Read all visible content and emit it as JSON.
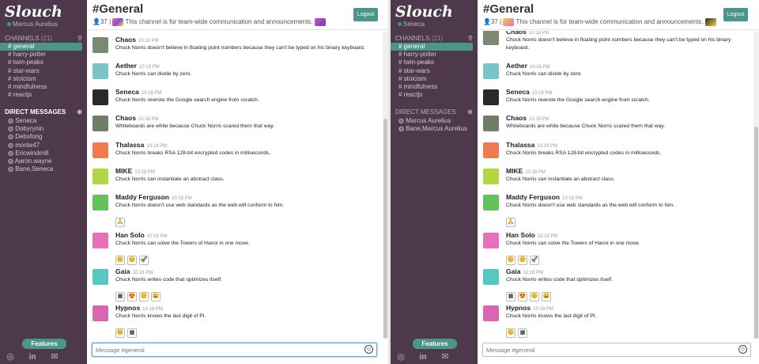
{
  "app": {
    "name": "Slouch"
  },
  "colors": {
    "sidebar": "#4d394b",
    "accent": "#4c9689",
    "presence": "#38978d"
  },
  "left": {
    "user": "Marcus Aurelius",
    "channels_label": "CHANNELS",
    "channels_count": "(21)",
    "channels": [
      "# general",
      "# harry-potter",
      "# twin-peaks",
      "# star-wars",
      "# stoicism",
      "# mindfulness",
      "# reactjs"
    ],
    "dm_label": "DIRECT MESSAGES",
    "dms": [
      "Seneca",
      "Dobyrynin",
      "Debsfong",
      "monte47",
      "Ericwindmill",
      "Aaron.wayne",
      "Bane,Seneca"
    ]
  },
  "right": {
    "user": "Seneca",
    "channels_label": "CHANNELS",
    "channels_count": "(21)",
    "channels": [
      "# general",
      "# harry-potter",
      "# twin-peaks",
      "# star-wars",
      "# stoicism",
      "# mindfulness",
      "# reactjs"
    ],
    "dm_label": "DIRECT MESSAGES",
    "dms": [
      "Marcus Aurelius",
      "Bane,Marcus Aurelius"
    ]
  },
  "features_label": "Features",
  "social_icons": [
    "github-icon",
    "linkedin-icon",
    "mail-icon"
  ],
  "channel": {
    "title": "#General",
    "members": "37",
    "separator": "|",
    "description": "This channel is for team-wide communication and announcements."
  },
  "logout_label": "Logout",
  "composer": {
    "placeholder": "Message #general"
  },
  "messages": [
    {
      "name": "Chaos",
      "time": "10:18 PM",
      "text": "Chuck Norris doesn't believe in floating point numbers because they can't be typed on his binary keyboard.",
      "avatar_color": "#7a8a70",
      "reactions": []
    },
    {
      "name": "Aether",
      "time": "10:18 PM",
      "text": "Chuck Norris can divide by zero.",
      "avatar_color": "#79c3c9",
      "reactions": []
    },
    {
      "name": "Seneca",
      "time": "10:18 PM",
      "text": "Chuck Norris rewrote the Google search engine from scratch.",
      "avatar_color": "#2a2a2a",
      "reactions": []
    },
    {
      "name": "Chaos",
      "time": "10:18 PM",
      "text": "Whiteboards are white because Chuck Norris scared them that way.",
      "avatar_color": "#6f7f66",
      "reactions": []
    },
    {
      "name": "Thalassa",
      "time": "10:18 PM",
      "text": "Chuck Norris breaks RSA 128-bit encrypted codes in milliseconds.",
      "avatar_color": "#f07b4e",
      "reactions": []
    },
    {
      "name": "MIKE",
      "time": "10:18 PM",
      "text": "Chuck Norris can instantiate an abstract class.",
      "avatar_color": "#b3d642",
      "reactions": []
    },
    {
      "name": "Maddy Ferguson",
      "time": "10:18 PM",
      "text": "Chuck Norris doesn't use web standards as the web will conform to him.",
      "avatar_color": "#63c35a",
      "reactions": [
        "🙏"
      ]
    },
    {
      "name": "Han Solo",
      "time": "10:18 PM",
      "text": "Chuck Norris can solve the Towers of Hanoi in one move.",
      "avatar_color": "#e86fb8",
      "reactions": [
        "😊",
        "😊",
        "🚀"
      ]
    },
    {
      "name": "Gaia",
      "time": "10:18 PM",
      "text": "Chuck Norris writes code that optimizes itself.",
      "avatar_color": "#55c9c0",
      "reactions": [
        "▦",
        "😍",
        "😊",
        "😀"
      ]
    },
    {
      "name": "Hypnos",
      "time": "10:18 PM",
      "text": "Chuck Norris knows the last digit of PI.",
      "avatar_color": "#d866b0",
      "reactions": [
        "😊",
        "▦"
      ]
    }
  ]
}
